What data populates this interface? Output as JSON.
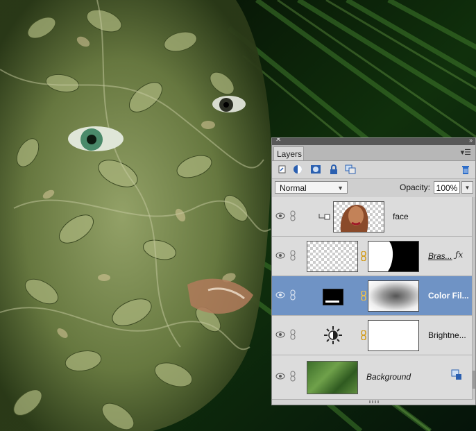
{
  "panel": {
    "tab_label": "Layers",
    "blend_mode": "Normal",
    "opacity_label": "Opacity:",
    "opacity_value": "100%"
  },
  "layers": [
    {
      "name": "face",
      "selected": false
    },
    {
      "name": "Bras...",
      "selected": false
    },
    {
      "name": "Color Fil...",
      "selected": true
    },
    {
      "name": "Brightne...",
      "selected": false
    },
    {
      "name": "Background",
      "selected": false
    }
  ],
  "colors": {
    "selection": "#6f93c5",
    "lock_icon": "#2a5fb0",
    "trash_icon": "#2c6cc8"
  },
  "icons": [
    "close-icon",
    "panel-menu-icon",
    "new-layer-icon",
    "adjustment-layer-icon",
    "mask-icon",
    "lock-icon",
    "link-layers-icon",
    "trash-icon",
    "eye-icon",
    "chain-icon",
    "sun-icon",
    "style-fx-icon"
  ]
}
